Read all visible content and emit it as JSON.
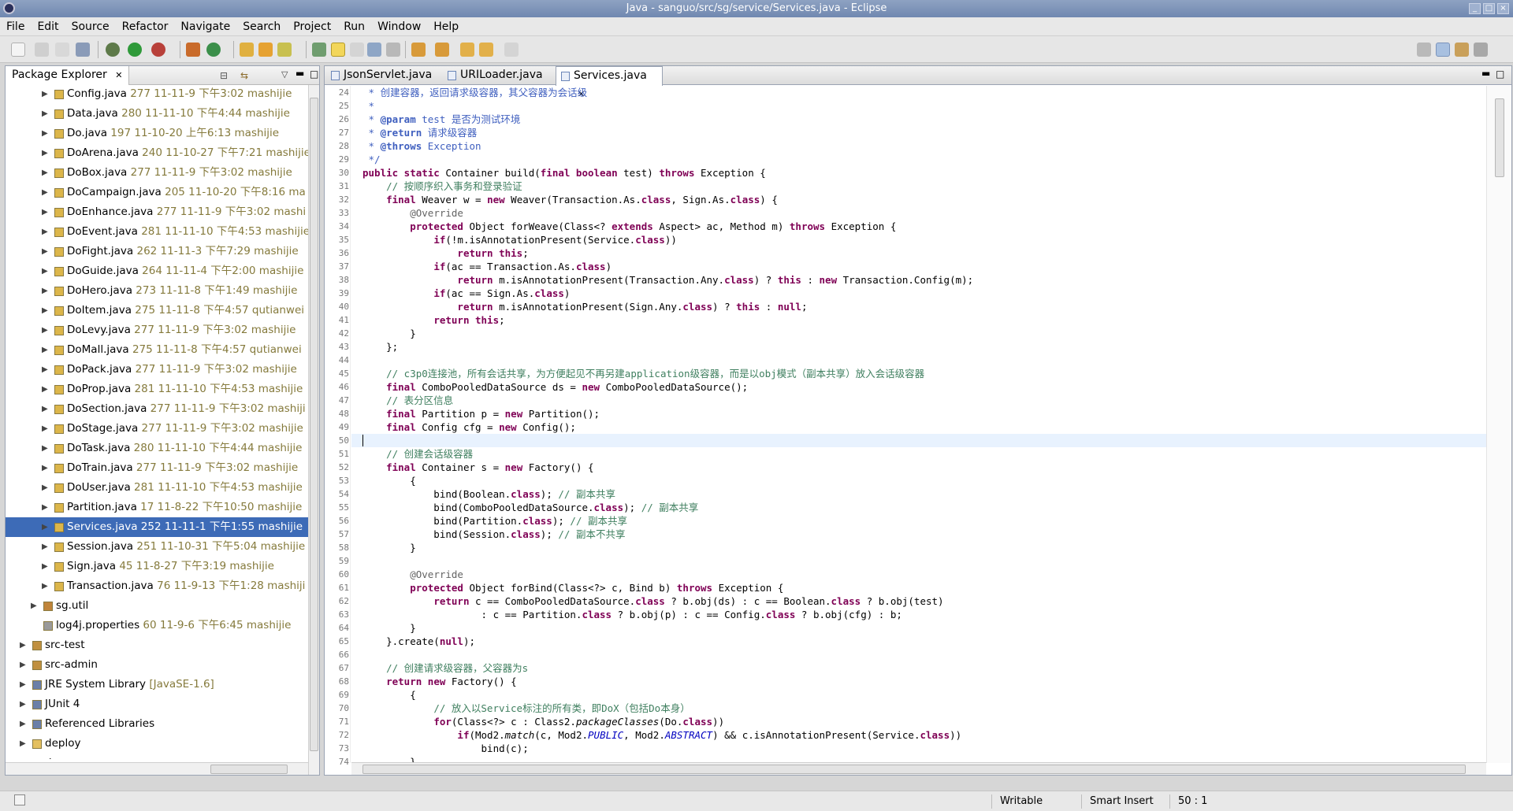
{
  "window": {
    "title": "Java - sanguo/src/sg/service/Services.java - Eclipse"
  },
  "menu": [
    "File",
    "Edit",
    "Source",
    "Refactor",
    "Navigate",
    "Search",
    "Project",
    "Run",
    "Window",
    "Help"
  ],
  "package_explorer": {
    "title": "Package Explorer",
    "items": [
      {
        "name": "Config.java",
        "meta": "277  11-11-9 下午3:02  mashijie"
      },
      {
        "name": "Data.java",
        "meta": "280  11-11-10 下午4:44  mashijie"
      },
      {
        "name": "Do.java",
        "meta": "197  11-10-20 上午6:13  mashijie"
      },
      {
        "name": "DoArena.java",
        "meta": "240  11-10-27 下午7:21  mashijie"
      },
      {
        "name": "DoBox.java",
        "meta": "277  11-11-9 下午3:02  mashijie"
      },
      {
        "name": "DoCampaign.java",
        "meta": "205  11-10-20 下午8:16  ma"
      },
      {
        "name": "DoEnhance.java",
        "meta": "277  11-11-9 下午3:02  mashi"
      },
      {
        "name": "DoEvent.java",
        "meta": "281  11-11-10 下午4:53  mashijie"
      },
      {
        "name": "DoFight.java",
        "meta": "262  11-11-3 下午7:29  mashijie"
      },
      {
        "name": "DoGuide.java",
        "meta": "264  11-11-4 下午2:00  mashijie"
      },
      {
        "name": "DoHero.java",
        "meta": "273  11-11-8 下午1:49  mashijie"
      },
      {
        "name": "DoItem.java",
        "meta": "275  11-11-8 下午4:57  qutianwei"
      },
      {
        "name": "DoLevy.java",
        "meta": "277  11-11-9 下午3:02  mashijie"
      },
      {
        "name": "DoMall.java",
        "meta": "275  11-11-8 下午4:57  qutianwei"
      },
      {
        "name": "DoPack.java",
        "meta": "277  11-11-9 下午3:02  mashijie"
      },
      {
        "name": "DoProp.java",
        "meta": "281  11-11-10 下午4:53  mashijie"
      },
      {
        "name": "DoSection.java",
        "meta": "277  11-11-9 下午3:02  mashiji"
      },
      {
        "name": "DoStage.java",
        "meta": "277  11-11-9 下午3:02  mashijie"
      },
      {
        "name": "DoTask.java",
        "meta": "280  11-11-10 下午4:44  mashijie"
      },
      {
        "name": "DoTrain.java",
        "meta": "277  11-11-9 下午3:02  mashijie"
      },
      {
        "name": "DoUser.java",
        "meta": "281  11-11-10 下午4:53  mashijie"
      },
      {
        "name": "Partition.java",
        "meta": "17  11-8-22 下午10:50  mashijie"
      },
      {
        "name": "Services.java",
        "meta": "252  11-11-1 下午1:55  mashijie"
      },
      {
        "name": "Session.java",
        "meta": "251  11-10-31 下午5:04  mashijie"
      },
      {
        "name": "Sign.java",
        "meta": "45  11-8-27 下午3:19  mashijie"
      },
      {
        "name": "Transaction.java",
        "meta": "76  11-9-13 下午1:28  mashiji"
      },
      {
        "name": "sg.util",
        "meta": ""
      },
      {
        "name": "log4j.properties",
        "meta": "60  11-9-6 下午6:45  mashijie"
      },
      {
        "name": "src-test",
        "meta": ""
      },
      {
        "name": "src-admin",
        "meta": ""
      },
      {
        "name": "JRE System Library",
        "meta": "[JavaSE-1.6]"
      },
      {
        "name": "JUnit 4",
        "meta": ""
      },
      {
        "name": "Referenced Libraries",
        "meta": ""
      },
      {
        "name": "deploy",
        "meta": ""
      },
      {
        "name": "doc",
        "meta": ""
      }
    ],
    "selected": "Services.java"
  },
  "editor": {
    "tabs": [
      "JsonServlet.java",
      "URILoader.java",
      "Services.java"
    ],
    "active_tab": "Services.java",
    "line_numbers": [
      "24",
      "25",
      "26",
      "27",
      "28",
      "29",
      "30",
      "31",
      "32",
      "33",
      "34",
      "35",
      "36",
      "37",
      "38",
      "39",
      "40",
      "41",
      "42",
      "43",
      "44",
      "45",
      "46",
      "47",
      "48",
      "49",
      "50",
      "51",
      "52",
      "53",
      "54",
      "55",
      "56",
      "57",
      "58",
      "59",
      "60",
      "61",
      "62",
      "63",
      "64",
      "65",
      "66",
      "67",
      "68",
      "69",
      "70",
      "71",
      "72",
      "73",
      "74"
    ],
    "current_line": "50"
  },
  "status": {
    "writable": "Writable",
    "insert_mode": "Smart Insert",
    "position": "50 : 1"
  },
  "colors": {
    "selection": "#3d6bb7",
    "keyword": "#7f0055",
    "comment": "#3f7f5f",
    "javadoc": "#3f5fbf"
  }
}
